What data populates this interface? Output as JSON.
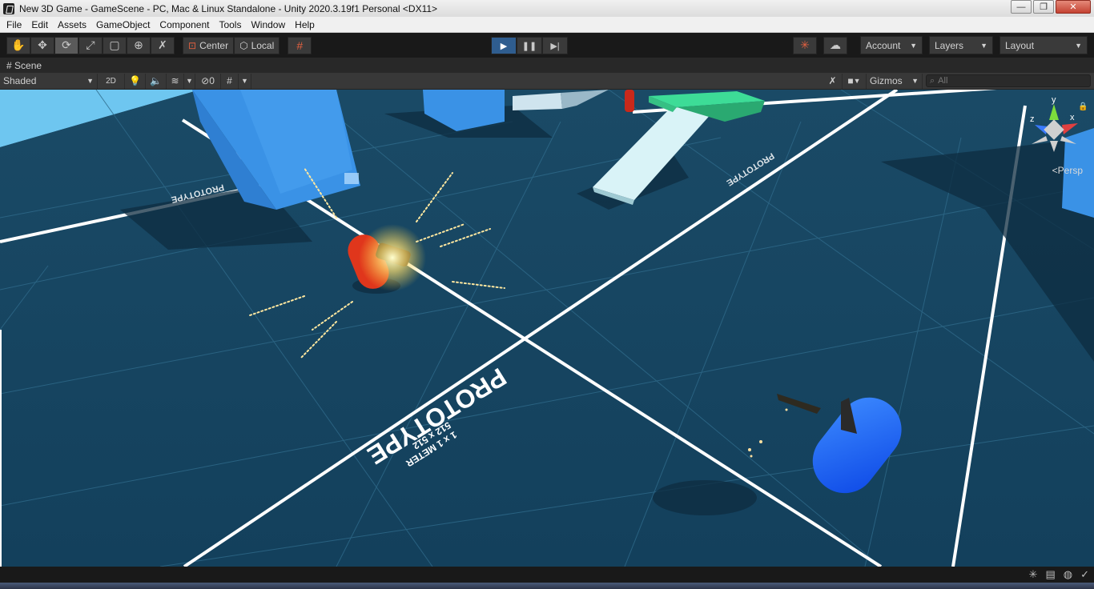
{
  "window": {
    "title": "New 3D Game - GameScene - PC, Mac & Linux Standalone - Unity 2020.3.19f1 Personal <DX11>",
    "controls": {
      "minimize": "—",
      "maximize": "❐",
      "close": "✕"
    }
  },
  "menubar": [
    "File",
    "Edit",
    "Assets",
    "GameObject",
    "Component",
    "Tools",
    "Window",
    "Help"
  ],
  "toolbar": {
    "transform_tools": [
      "hand-tool",
      "move-tool",
      "rotate-tool",
      "scale-tool",
      "rect-tool",
      "transform-tool",
      "custom-tool"
    ],
    "active_tool": "rotate-tool",
    "pivot_mode": "Center",
    "pivot_rotation": "Local",
    "account": "Account",
    "layers": "Layers",
    "layout": "Layout"
  },
  "scene_tab": {
    "label": "Scene"
  },
  "scene_toolbar": {
    "draw_mode": "Shaded",
    "mode_2d": "2D",
    "hidden_count": "0",
    "gizmos": "Gizmos",
    "search_placeholder": "All"
  },
  "viewport": {
    "projection": "Persp",
    "axes": {
      "x": "x",
      "y": "y",
      "z": "z"
    },
    "floor_label": {
      "title": "PROTOTYPE",
      "line1": "1 x 1 METER",
      "line2": "512 x 512"
    },
    "colors": {
      "floor": "#17435f",
      "grid": "#ffffff",
      "cube": "#3a8fe0",
      "ramp": "#d9f3f7",
      "platform": "#3ddc97",
      "red_capsule": "#e0361c",
      "blue_capsule": "#1760ff"
    }
  }
}
